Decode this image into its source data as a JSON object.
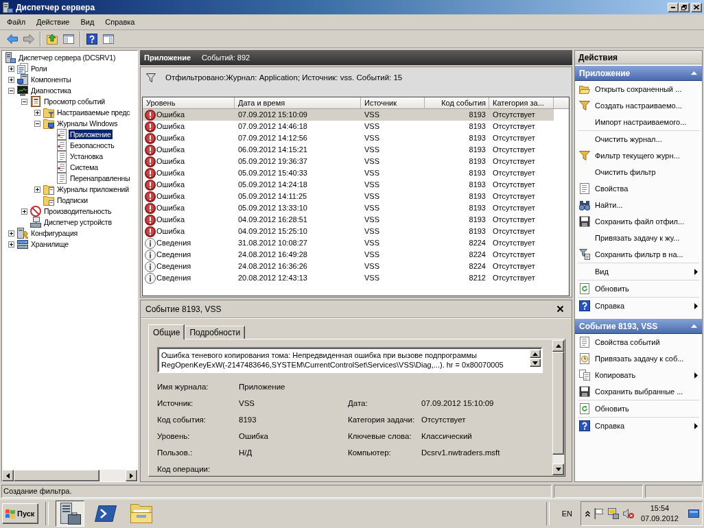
{
  "window": {
    "title": "Диспетчер сервера"
  },
  "menu": [
    "Файл",
    "Действие",
    "Вид",
    "Справка"
  ],
  "toolbar": [
    [
      {
        "kind": "back",
        "disabled": false
      },
      {
        "kind": "forward",
        "disabled": true
      }
    ],
    [
      {
        "kind": "up",
        "disabled": false
      },
      {
        "kind": "tree",
        "disabled": false
      }
    ],
    [
      {
        "kind": "help",
        "disabled": false
      },
      {
        "kind": "actions",
        "disabled": false
      }
    ]
  ],
  "tree": [
    {
      "label": "Диспетчер сервера (DCSRV1)",
      "kind": "server",
      "selected": false,
      "children": [
        {
          "label": "Роли",
          "kind": "roles",
          "expanded": false,
          "selected": false
        },
        {
          "label": "Компоненты",
          "kind": "features",
          "expanded": false,
          "selected": false
        },
        {
          "label": "Диагностика",
          "kind": "diagnostics",
          "expanded": true,
          "selected": false,
          "children": [
            {
              "label": "Просмотр событий",
              "kind": "eventviewer",
              "expanded": true,
              "selected": false,
              "children": [
                {
                  "label": "Настраиваемые предс",
                  "kind": "customviews",
                  "expanded": false,
                  "selected": false
                },
                {
                  "label": "Журналы Windows",
                  "kind": "windowslogs",
                  "expanded": true,
                  "selected": false,
                  "children": [
                    {
                      "label": "Приложение",
                      "kind": "log",
                      "selected": true
                    },
                    {
                      "label": "Безопасность",
                      "kind": "log",
                      "selected": false
                    },
                    {
                      "label": "Установка",
                      "kind": "emptylog",
                      "selected": false
                    },
                    {
                      "label": "Система",
                      "kind": "log",
                      "selected": false
                    },
                    {
                      "label": "Перенаправленны",
                      "kind": "emptylog",
                      "selected": false
                    }
                  ]
                },
                {
                  "label": "Журналы приложений",
                  "kind": "appfolder",
                  "expanded": false,
                  "selected": false
                },
                {
                  "label": "Подписки",
                  "kind": "subscriptions",
                  "selected": false
                }
              ]
            },
            {
              "label": "Производительность",
              "kind": "performance",
              "expanded": false,
              "selected": false
            },
            {
              "label": "Диспетчер устройств",
              "kind": "devices",
              "selected": false
            }
          ]
        },
        {
          "label": "Конфигурация",
          "kind": "configuration",
          "expanded": false,
          "selected": false
        },
        {
          "label": "Хранилище",
          "kind": "storage",
          "expanded": false,
          "selected": false
        }
      ]
    }
  ],
  "events": {
    "title": "Приложение",
    "count": "Событий: 892",
    "filter": "Отфильтровано:Журнал: Application; Источник: vss. Событий: 15",
    "columns": [
      "Уровень",
      "Дата и время",
      "Источник",
      "Код события",
      "Категория за..."
    ],
    "rows": [
      {
        "kind": "error",
        "severity": "Ошибка",
        "date": "07.09.2012 15:10:09",
        "source": "VSS",
        "event_id": "8193",
        "category": "Отсутствует",
        "selected": true
      },
      {
        "kind": "error",
        "severity": "Ошибка",
        "date": "07.09.2012 14:46:18",
        "source": "VSS",
        "event_id": "8193",
        "category": "Отсутствует",
        "selected": false
      },
      {
        "kind": "error",
        "severity": "Ошибка",
        "date": "07.09.2012 14:12:56",
        "source": "VSS",
        "event_id": "8193",
        "category": "Отсутствует",
        "selected": false
      },
      {
        "kind": "error",
        "severity": "Ошибка",
        "date": "06.09.2012 14:15:21",
        "source": "VSS",
        "event_id": "8193",
        "category": "Отсутствует",
        "selected": false
      },
      {
        "kind": "error",
        "severity": "Ошибка",
        "date": "05.09.2012 19:36:37",
        "source": "VSS",
        "event_id": "8193",
        "category": "Отсутствует",
        "selected": false
      },
      {
        "kind": "error",
        "severity": "Ошибка",
        "date": "05.09.2012 15:40:33",
        "source": "VSS",
        "event_id": "8193",
        "category": "Отсутствует",
        "selected": false
      },
      {
        "kind": "error",
        "severity": "Ошибка",
        "date": "05.09.2012 14:24:18",
        "source": "VSS",
        "event_id": "8193",
        "category": "Отсутствует",
        "selected": false
      },
      {
        "kind": "error",
        "severity": "Ошибка",
        "date": "05.09.2012 14:11:25",
        "source": "VSS",
        "event_id": "8193",
        "category": "Отсутствует",
        "selected": false
      },
      {
        "kind": "error",
        "severity": "Ошибка",
        "date": "05.09.2012 13:33:10",
        "source": "VSS",
        "event_id": "8193",
        "category": "Отсутствует",
        "selected": false
      },
      {
        "kind": "error",
        "severity": "Ошибка",
        "date": "04.09.2012 16:28:51",
        "source": "VSS",
        "event_id": "8193",
        "category": "Отсутствует",
        "selected": false
      },
      {
        "kind": "error",
        "severity": "Ошибка",
        "date": "04.09.2012 15:25:10",
        "source": "VSS",
        "event_id": "8193",
        "category": "Отсутствует",
        "selected": false
      },
      {
        "kind": "info",
        "severity": "Сведения",
        "date": "31.08.2012 10:08:27",
        "source": "VSS",
        "event_id": "8224",
        "category": "Отсутствует",
        "selected": false
      },
      {
        "kind": "info",
        "severity": "Сведения",
        "date": "24.08.2012 16:49:28",
        "source": "VSS",
        "event_id": "8224",
        "category": "Отсутствует",
        "selected": false
      },
      {
        "kind": "info",
        "severity": "Сведения",
        "date": "24.08.2012 16:36:26",
        "source": "VSS",
        "event_id": "8224",
        "category": "Отсутствует",
        "selected": false
      },
      {
        "kind": "info",
        "severity": "Сведения",
        "date": "20.08.2012 12:43:13",
        "source": "VSS",
        "event_id": "8212",
        "category": "Отсутствует",
        "selected": false
      }
    ]
  },
  "detail": {
    "title": "Событие 8193, VSS",
    "tabs": [
      {
        "label": "Общие",
        "selected": true
      },
      {
        "label": "Подробности",
        "selected": false
      }
    ],
    "description": "Ошибка теневого копирования тома: Непредвиденная ошибка при вызове подпрограммы RegOpenKeyExW(-2147483646,SYSTEM\\CurrentControlSet\\Services\\VSS\\Diag,...). hr = 0x80070005",
    "fields": [
      [
        {
          "label": "Имя журнала:",
          "value": "Приложение"
        }
      ],
      [
        {
          "label": "Источник:",
          "value": "VSS"
        },
        {
          "label": "Дата:",
          "value": "07.09.2012 15:10:09"
        }
      ],
      [
        {
          "label": "Код события:",
          "value": "8193"
        },
        {
          "label": "Категория задачи:",
          "value": "Отсутствует"
        }
      ],
      [
        {
          "label": "Уровень:",
          "value": "Ошибка"
        },
        {
          "label": "Ключевые слова:",
          "value": "Классический"
        }
      ],
      [
        {
          "label": "Пользов.:",
          "value": "Н/Д"
        },
        {
          "label": "Компьютер:",
          "value": "Dcsrv1.nwtraders.msft"
        }
      ],
      [
        {
          "label": "Код операции:"
        }
      ]
    ]
  },
  "actions": {
    "title": "Действия",
    "sections": [
      {
        "title": "Приложение",
        "expanded": true,
        "groups": [
          [
            {
              "label": "Открыть сохраненный ...",
              "kind": "open",
              "submenu": false
            },
            {
              "label": "Создать настраиваемо...",
              "kind": "filter",
              "submenu": false
            },
            {
              "label": "Импорт настраиваемого...",
              "kind": "plain",
              "submenu": false
            }
          ],
          [
            {
              "label": "Очистить журнал...",
              "kind": "plain",
              "submenu": false
            },
            {
              "label": "Фильтр текущего журн...",
              "kind": "filter",
              "submenu": false
            },
            {
              "label": "Очистить фильтр",
              "kind": "plain",
              "submenu": false
            },
            {
              "label": "Свойства",
              "kind": "properties",
              "submenu": false
            },
            {
              "label": "Найти...",
              "kind": "find",
              "submenu": false
            },
            {
              "label": "Сохранить файл отфил...",
              "kind": "save",
              "submenu": false
            },
            {
              "label": "Привязать задачу к жу...",
              "kind": "plain",
              "submenu": false
            },
            {
              "label": "Сохранить фильтр в на...",
              "kind": "filtersave",
              "submenu": false
            }
          ],
          [
            {
              "label": "Вид",
              "kind": "plain",
              "submenu": true
            }
          ],
          [
            {
              "label": "Обновить",
              "kind": "refresh",
              "submenu": false
            }
          ],
          [
            {
              "label": "Справка",
              "kind": "help",
              "submenu": true
            }
          ]
        ]
      },
      {
        "title": "Событие 8193, VSS",
        "expanded": true,
        "groups": [
          [
            {
              "label": "Свойства событий",
              "kind": "properties",
              "submenu": false
            },
            {
              "label": "Привязать задачу к соб...",
              "kind": "task",
              "submenu": false
            },
            {
              "label": "Копировать",
              "kind": "copy",
              "submenu": true
            },
            {
              "label": "Сохранить выбранные ...",
              "kind": "save",
              "submenu": false
            }
          ],
          [
            {
              "label": "Обновить",
              "kind": "refresh",
              "submenu": false
            }
          ],
          [
            {
              "label": "Справка",
              "kind": "help",
              "submenu": true
            }
          ]
        ]
      }
    ]
  },
  "status_bar": {
    "text": "Создание фильтра."
  },
  "taskbar": {
    "start": "Пуск",
    "apps": [
      {
        "kind": "servermanager",
        "selected": true
      },
      {
        "kind": "powershell",
        "selected": false
      },
      {
        "kind": "explorer",
        "selected": false
      }
    ],
    "language": "EN",
    "time": "15:54",
    "date": "07.09.2012"
  }
}
